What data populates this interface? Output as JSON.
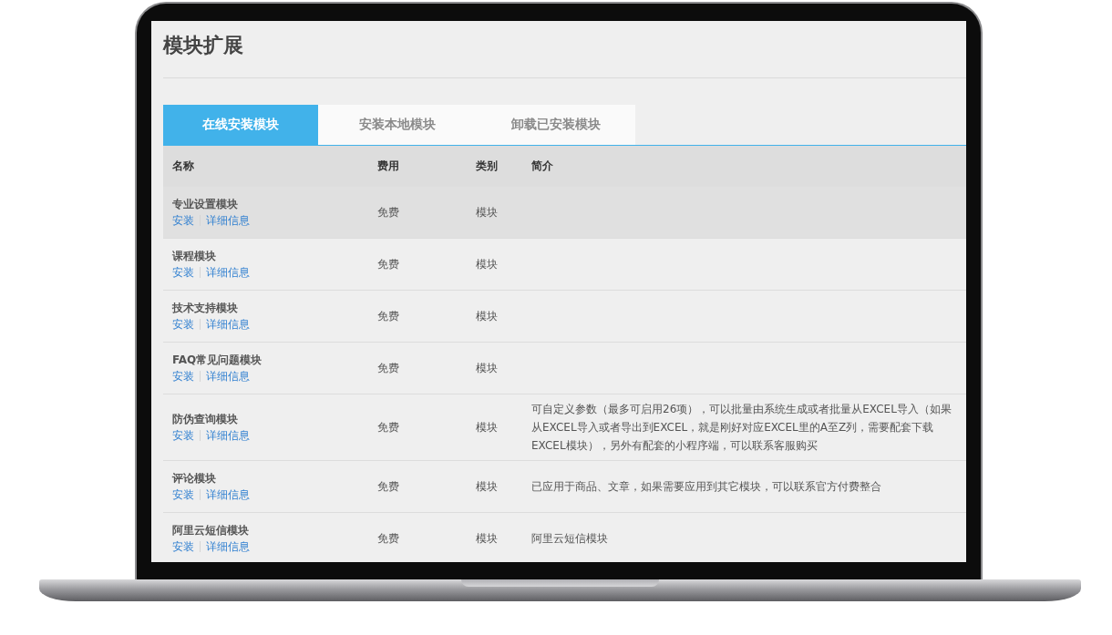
{
  "page": {
    "title": "模块扩展"
  },
  "tabs": [
    {
      "label": "在线安装模块",
      "selected": true
    },
    {
      "label": "安装本地模块",
      "selected": false
    },
    {
      "label": "卸载已安装模块",
      "selected": false
    }
  ],
  "table": {
    "columns": [
      "名称",
      "费用",
      "类别",
      "简介"
    ],
    "rows": [
      {
        "name": "专业设置模块",
        "actions": [
          "安装",
          "详细信息"
        ],
        "fee": "免费",
        "category": "模块",
        "description": "",
        "highlighted": true
      },
      {
        "name": "课程模块",
        "actions": [
          "安装",
          "详细信息"
        ],
        "fee": "免费",
        "category": "模块",
        "description": "",
        "highlighted": false
      },
      {
        "name": "技术支持模块",
        "actions": [
          "安装",
          "详细信息"
        ],
        "fee": "免费",
        "category": "模块",
        "description": "",
        "highlighted": false
      },
      {
        "name": "FAQ常见问题模块",
        "actions": [
          "安装",
          "详细信息"
        ],
        "fee": "免费",
        "category": "模块",
        "description": "",
        "highlighted": false
      },
      {
        "name": "防伪查询模块",
        "actions": [
          "安装",
          "详细信息"
        ],
        "fee": "免费",
        "category": "模块",
        "description": "可自定义参数（最多可启用26项），可以批量由系统生成或者批量从EXCEL导入（如果从EXCEL导入或者导出到EXCEL，就是刚好对应EXCEL里的A至Z列，需要配套下载EXCEL模块），另外有配套的小程序端，可以联系客服购买",
        "highlighted": false
      },
      {
        "name": "评论模块",
        "actions": [
          "安装",
          "详细信息"
        ],
        "fee": "免费",
        "category": "模块",
        "description": "已应用于商品、文章，如果需要应用到其它模块，可以联系官方付费整合",
        "highlighted": false
      },
      {
        "name": "阿里云短信模块",
        "actions": [
          "安装",
          "详细信息"
        ],
        "fee": "免费",
        "category": "模块",
        "description": "阿里云短信模块",
        "highlighted": false
      }
    ]
  }
}
